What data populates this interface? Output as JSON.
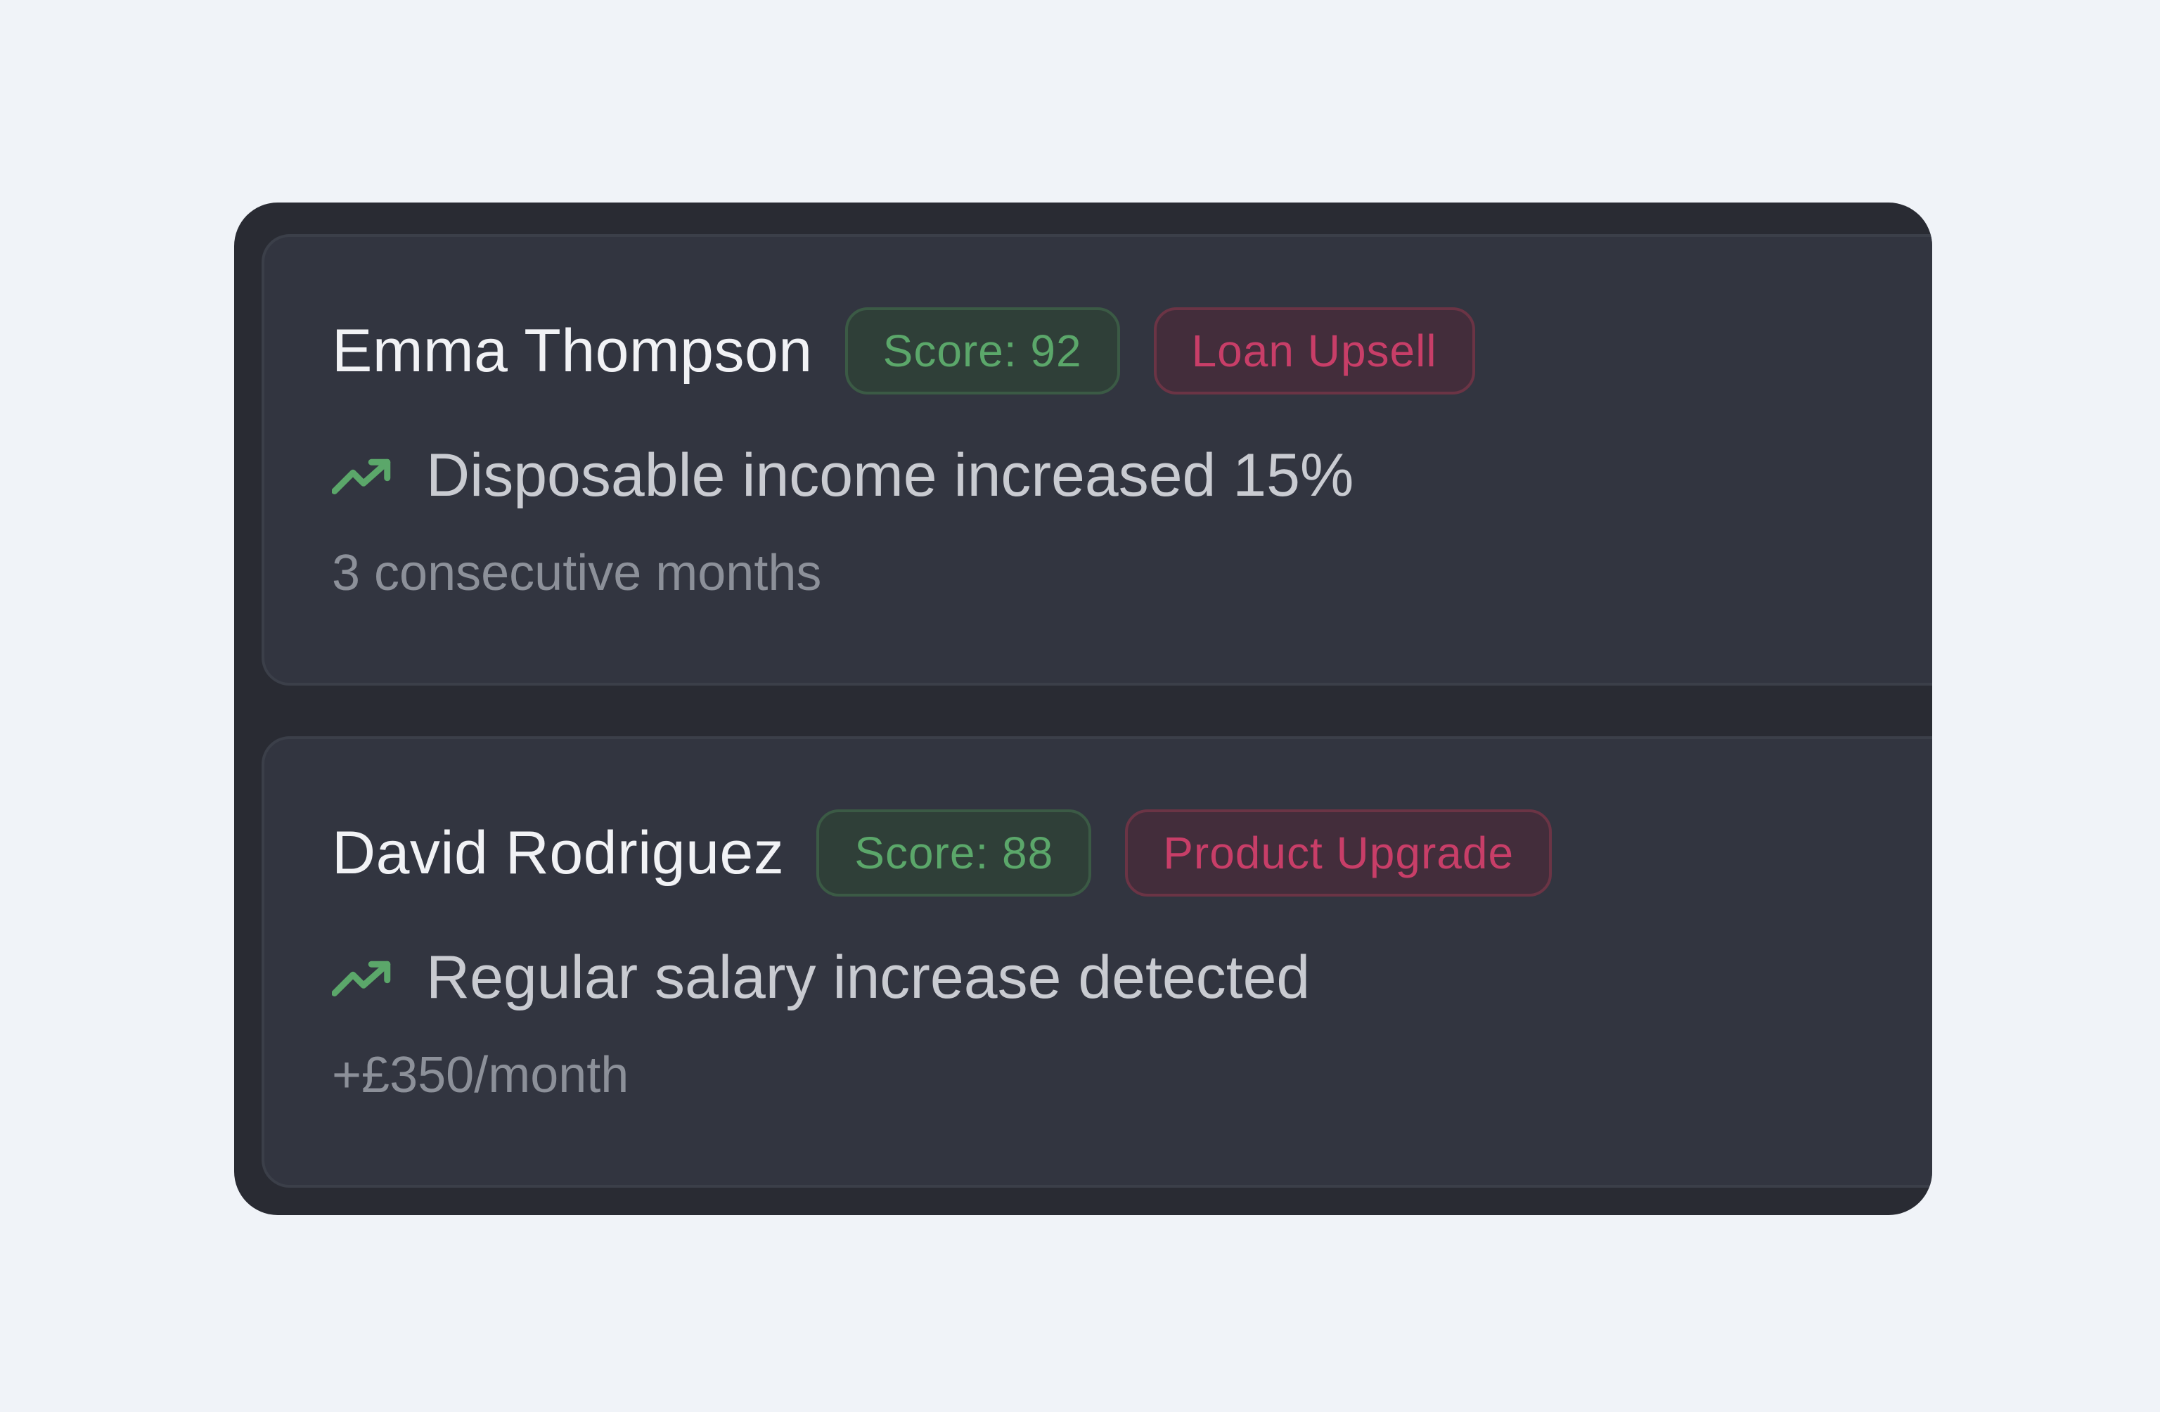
{
  "colors": {
    "page_background": "#f0f3f8",
    "panel_background": "#292b33",
    "card_background": "#323540",
    "score_green": "#5ba76a",
    "tag_pink": "#c83e68",
    "trend_icon_green": "#5ba76a"
  },
  "cards": [
    {
      "name": "Emma Thompson",
      "score_label": "Score: 92",
      "tag": "Loan Upsell",
      "insight_icon": "trending-up-icon",
      "insight": "Disposable income increased 15%",
      "detail": "3 consecutive months"
    },
    {
      "name": "David Rodriguez",
      "score_label": "Score: 88",
      "tag": "Product Upgrade",
      "insight_icon": "trending-up-icon",
      "insight": "Regular salary increase detected",
      "detail": "+£350/month"
    }
  ]
}
